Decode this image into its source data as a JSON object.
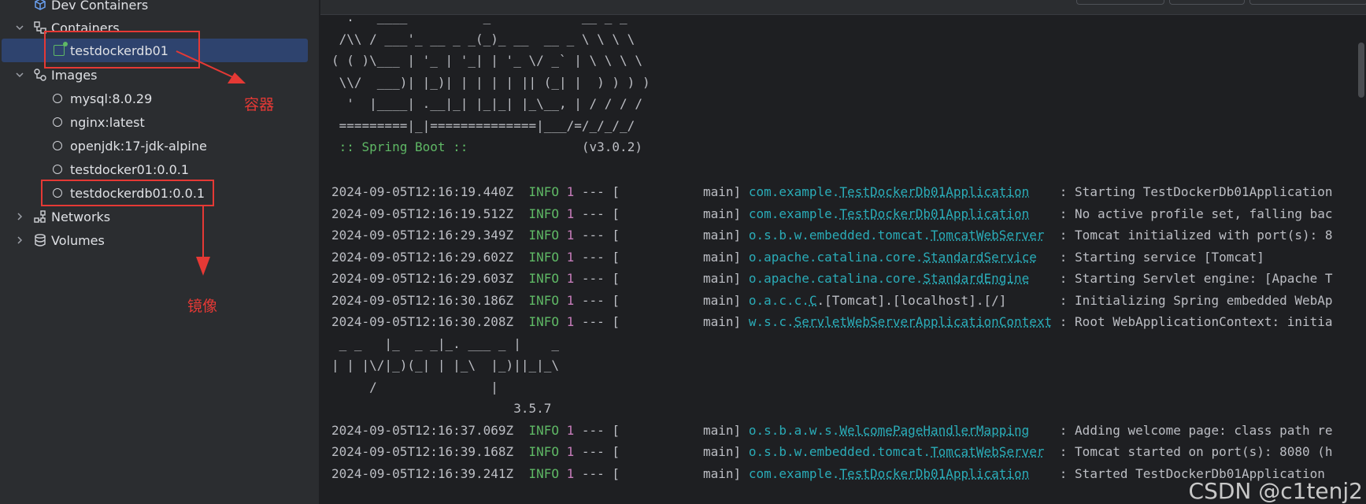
{
  "sidebar": {
    "dev_containers": "Dev Containers",
    "containers": "Containers",
    "container_item": "testdockerdb01",
    "images": "Images",
    "image_items": [
      "mysql:8.0.29",
      "nginx:latest",
      "openjdk:17-jdk-alpine",
      "testdocker01:0.0.1",
      "testdockerdb01:0.0.1"
    ],
    "networks": "Networks",
    "volumes": "Volumes"
  },
  "annotations": {
    "container_label": "容器",
    "image_label": "镜像"
  },
  "console": {
    "banner": [
      "  .   ____          _            __ _ _",
      " /\\\\ / ___'_ __ _ _(_)_ __  __ _ \\ \\ \\ \\",
      "( ( )\\___ | '_ | '_| | '_ \\/ _` | \\ \\ \\ \\",
      " \\\\/  ___)| |_)| | | | | || (_| |  ) ) ) )",
      "  '  |____| .__|_| |_|_| |_\\__, | / / / /",
      " =========|_|==============|___/=/_/_/_/"
    ],
    "boot_label": " :: Spring Boot :: ",
    "boot_version": "              (v3.0.2)",
    "mybatis_banner": [
      " _ _   |_  _ _|_. ___ _ |    _",
      "| | |\\/|_)(_| | |_\\  |_)||_|_\\",
      "     /               |",
      "                        3.5.7"
    ],
    "logs1": [
      {
        "ts": "2024-09-05T12:16:19.440Z",
        "level": "INFO",
        "pid": "1",
        "sep": " --- [           main] ",
        "pkg": "com.example.",
        "cls": "TestDockerDb01Application",
        "pad": "    ",
        "msg": ": Starting TestDockerDb01Application"
      },
      {
        "ts": "2024-09-05T12:16:19.512Z",
        "level": "INFO",
        "pid": "1",
        "sep": " --- [           main] ",
        "pkg": "com.example.",
        "cls": "TestDockerDb01Application",
        "pad": "    ",
        "msg": ": No active profile set, falling bac"
      },
      {
        "ts": "2024-09-05T12:16:29.349Z",
        "level": "INFO",
        "pid": "1",
        "sep": " --- [           main] ",
        "pkg": "o.s.b.w.embedded.tomcat.",
        "cls": "TomcatWebServer",
        "pad": "  ",
        "msg": ": Tomcat initialized with port(s): 8"
      },
      {
        "ts": "2024-09-05T12:16:29.602Z",
        "level": "INFO",
        "pid": "1",
        "sep": " --- [           main] ",
        "pkg": "o.apache.catalina.core.",
        "cls": "StandardService",
        "pad": "   ",
        "msg": ": Starting service [Tomcat]"
      },
      {
        "ts": "2024-09-05T12:16:29.603Z",
        "level": "INFO",
        "pid": "1",
        "sep": " --- [           main] ",
        "pkg": "o.apache.catalina.core.",
        "cls": "StandardEngine",
        "pad": "    ",
        "msg": ": Starting Servlet engine: [Apache T"
      },
      {
        "ts": "2024-09-05T12:16:30.186Z",
        "level": "INFO",
        "pid": "1",
        "sep": " --- [           main] ",
        "pkg": "o.a.c.c.",
        "cls": "C",
        "pad": "",
        "msg": ".[Tomcat].[localhost].[/]       : Initializing Spring embedded WebAp"
      },
      {
        "ts": "2024-09-05T12:16:30.208Z",
        "level": "INFO",
        "pid": "1",
        "sep": " --- [           main] ",
        "pkg": "w.s.c.",
        "cls": "ServletWebServerApplicationContext",
        "pad": " ",
        "msg": ": Root WebApplicationContext: initia"
      }
    ],
    "logs2": [
      {
        "ts": "2024-09-05T12:16:37.069Z",
        "level": "INFO",
        "pid": "1",
        "sep": " --- [           main] ",
        "pkg": "o.s.b.a.w.s.",
        "cls": "WelcomePageHandlerMapping",
        "pad": "    ",
        "msg": ": Adding welcome page: class path re"
      },
      {
        "ts": "2024-09-05T12:16:39.168Z",
        "level": "INFO",
        "pid": "1",
        "sep": " --- [           main] ",
        "pkg": "o.s.b.w.embedded.tomcat.",
        "cls": "TomcatWebServer",
        "pad": "  ",
        "msg": ": Tomcat started on port(s): 8080 (h"
      },
      {
        "ts": "2024-09-05T12:16:39.241Z",
        "level": "INFO",
        "pid": "1",
        "sep": " --- [           main] ",
        "pkg": "com.example.",
        "cls": "TestDockerDb01Application",
        "pad": "    ",
        "msg": ": Started TestDockerDb01Application"
      }
    ]
  },
  "watermark": "CSDN @c1tenj2"
}
